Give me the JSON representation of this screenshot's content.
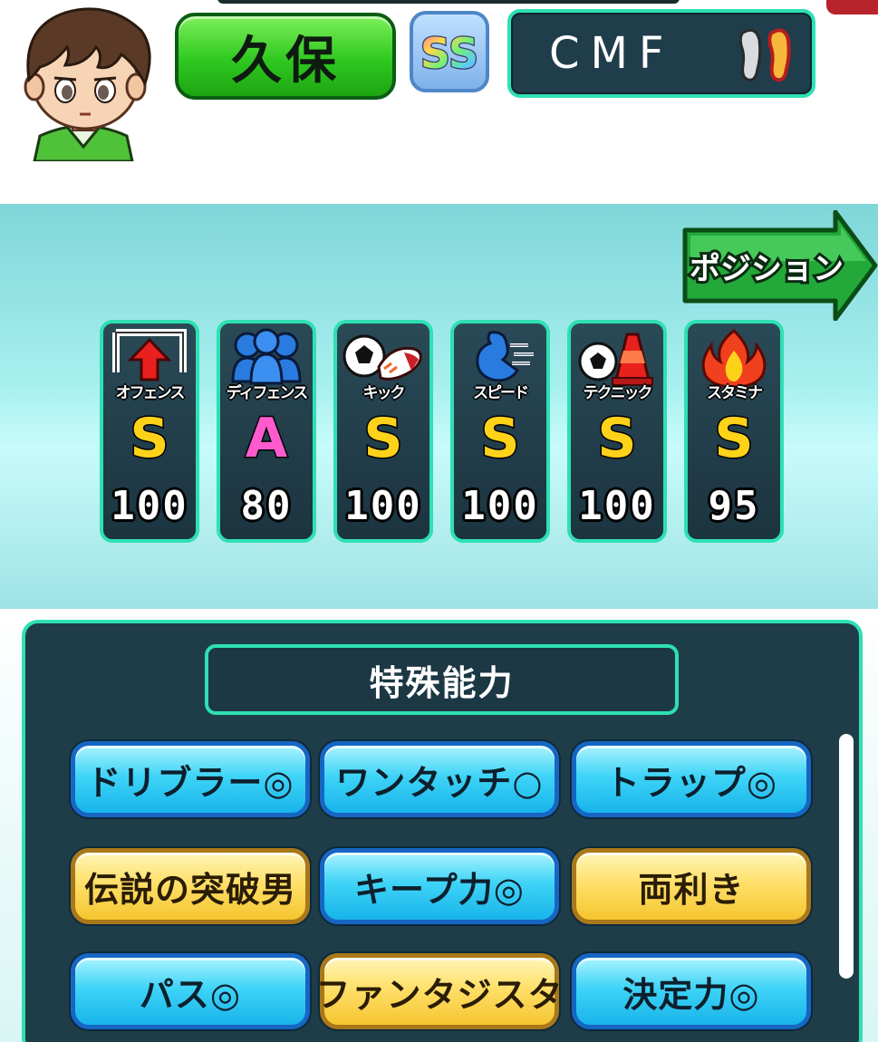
{
  "player": {
    "name": "久保",
    "rank": "SS",
    "position": "CMF"
  },
  "navigation": {
    "position_button": "ポジション"
  },
  "stats": [
    {
      "label": "オフェンス",
      "grade": "S",
      "value": "100",
      "icon": "offense-icon"
    },
    {
      "label": "ディフェンス",
      "grade": "A",
      "value": "80",
      "icon": "defense-icon"
    },
    {
      "label": "キック",
      "grade": "S",
      "value": "100",
      "icon": "kick-icon"
    },
    {
      "label": "スピード",
      "grade": "S",
      "value": "100",
      "icon": "speed-icon"
    },
    {
      "label": "テクニック",
      "grade": "S",
      "value": "100",
      "icon": "technique-icon"
    },
    {
      "label": "スタミナ",
      "grade": "S",
      "value": "95",
      "icon": "stamina-icon"
    }
  ],
  "abilities": {
    "title": "特殊能力",
    "items": [
      {
        "label": "ドリブラー◎",
        "style": "blue"
      },
      {
        "label": "ワンタッチ○",
        "style": "blue"
      },
      {
        "label": "トラップ◎",
        "style": "blue"
      },
      {
        "label": "伝説の突破男",
        "style": "gold"
      },
      {
        "label": "キープ力◎",
        "style": "blue"
      },
      {
        "label": "両利き",
        "style": "gold"
      },
      {
        "label": "パス◎",
        "style": "blue"
      },
      {
        "label": "ファンタジスタ",
        "style": "gold"
      },
      {
        "label": "決定力◎",
        "style": "blue"
      }
    ]
  },
  "colors": {
    "accent_teal": "#2ee0b4",
    "panel_dark": "#1e3d49",
    "name_green": "#2fc820",
    "grade_s": "#ffd21a",
    "grade_a": "#ff5bcf"
  }
}
